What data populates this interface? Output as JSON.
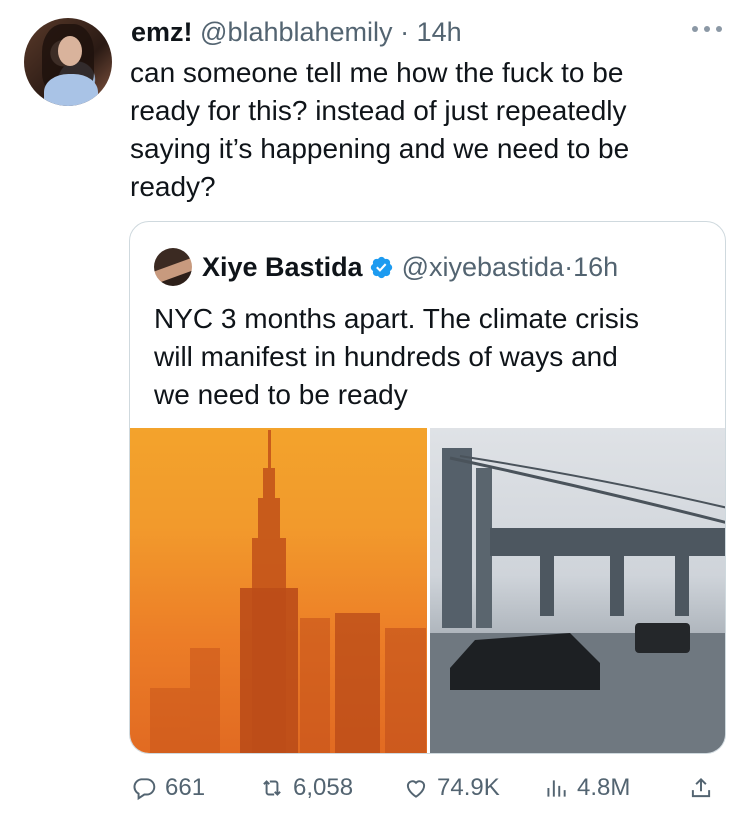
{
  "tweet": {
    "name": "emz!",
    "handle": "@blahblahemily",
    "separator": "·",
    "time": "14h",
    "text": "can someone tell me how the fuck to be\nready for this? instead of just repeatedly\nsaying it’s happening and we need to be\nready?",
    "more_icon": "more-dots-icon"
  },
  "quoted": {
    "name": "Xiye Bastida",
    "handle": "@xiyebastida",
    "separator": "·",
    "time": "16h",
    "text": "NYC 3 months apart. The climate crisis\nwill manifest in hundreds of ways and\nwe need to be ready",
    "verified_color": "#1d9bf0"
  },
  "actions": {
    "replies": "661",
    "retweets": "6,058",
    "likes": "74.9K",
    "views": "4.8M"
  },
  "colors": {
    "text": "#0f1419",
    "secondary": "#536471",
    "border": "#cfd9de",
    "accent": "#1d9bf0"
  }
}
